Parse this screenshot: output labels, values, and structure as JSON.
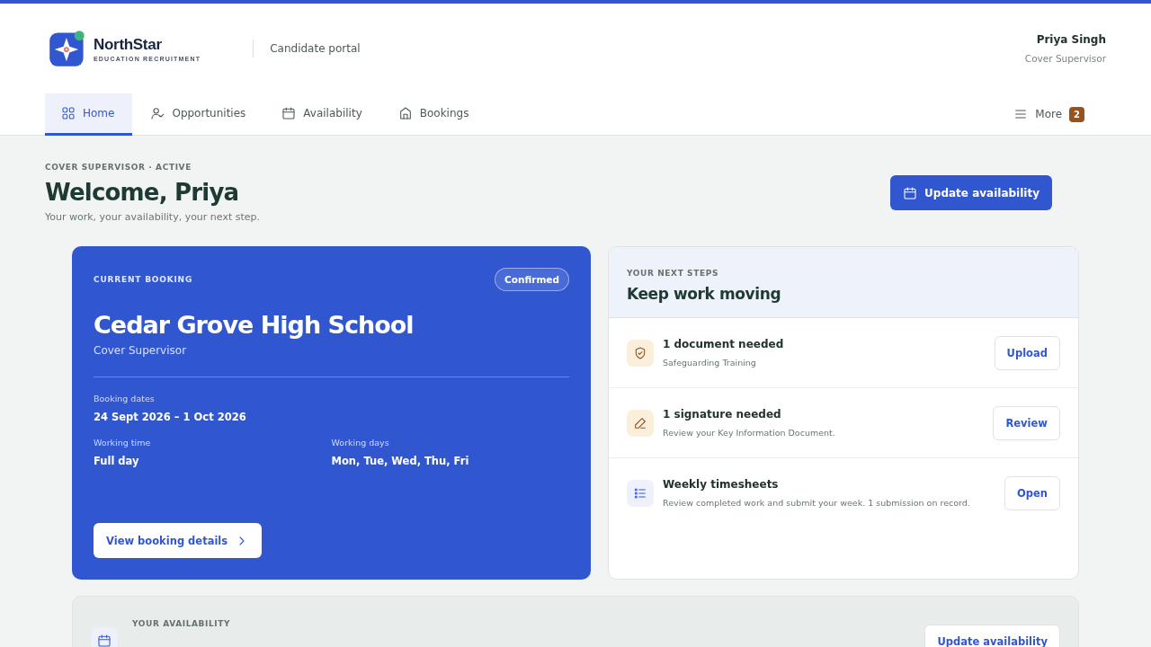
{
  "brand": {
    "name": "NorthStar",
    "tagline": "EDUCATION RECRUITMENT",
    "portal": "Candidate portal"
  },
  "user": {
    "name": "Priya Singh",
    "role": "Cover Supervisor"
  },
  "tabs": [
    {
      "label": "Home",
      "selected": true
    },
    {
      "label": "Opportunities",
      "selected": false
    },
    {
      "label": "Availability",
      "selected": false
    },
    {
      "label": "Bookings",
      "selected": false
    }
  ],
  "more": {
    "label": "More",
    "badge": "2"
  },
  "intro": {
    "eyebrow": "COVER SUPERVISOR · ACTIVE",
    "title": "Welcome, Priya",
    "subtitle": "Your work, your availability, your next step.",
    "action": "Update availability"
  },
  "booking": {
    "eyebrow": "CURRENT BOOKING",
    "status": "Confirmed",
    "school": "Cedar Grove High School",
    "role": "Cover Supervisor",
    "details": [
      {
        "label": "Booking dates",
        "value": "24 Sept 2026 – 1 Oct 2026"
      },
      {
        "label": "Working time",
        "value": "Full day"
      },
      {
        "label": "Working days",
        "value": "Mon, Tue, Wed, Thu, Fri"
      }
    ],
    "action": "View booking details"
  },
  "next_steps": {
    "eyebrow": "YOUR NEXT STEPS",
    "title": "Keep work moving",
    "items": [
      {
        "title": "1 document needed",
        "text": "Safeguarding Training",
        "action": "Upload"
      },
      {
        "title": "1 signature needed",
        "text": "Review your Key Information Document.",
        "action": "Review"
      },
      {
        "title": "Weekly timesheets",
        "text": "Review completed work and submit your week. 1 submission on record.",
        "action": "Open"
      }
    ]
  },
  "availability": {
    "eyebrow": "YOUR AVAILABILITY",
    "action": "Update availability"
  }
}
